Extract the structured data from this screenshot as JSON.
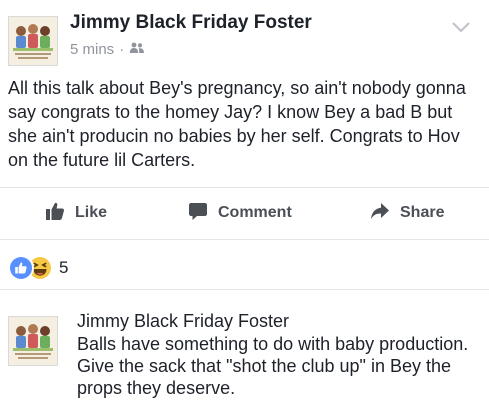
{
  "post": {
    "author": "Jimmy Black Friday Foster",
    "time": "5 mins",
    "separator": "·",
    "privacy_icon": "friends-icon",
    "body": "All this talk about Bey's pregnancy, so ain't nobody gonna say congrats to the homey Jay? I know Bey a bad B but she ain't producin no babies by her self. Congrats to Hov on the future lil Carters.",
    "actions": {
      "like": "Like",
      "comment": "Comment",
      "share": "Share"
    },
    "reactions": {
      "icons": [
        "like-reaction-icon",
        "haha-reaction-icon"
      ],
      "count": "5"
    }
  },
  "comment": {
    "author": "Jimmy Black Friday Foster",
    "body": "Balls have something to do with baby production. Give the sack that \"shot the club up\" in Bey the props they deserve."
  },
  "colors": {
    "text": "#1d2129",
    "meta": "#90949c",
    "action": "#4b4f56",
    "like_blue": "#5890ff",
    "haha_yellow": "#f7c844"
  }
}
